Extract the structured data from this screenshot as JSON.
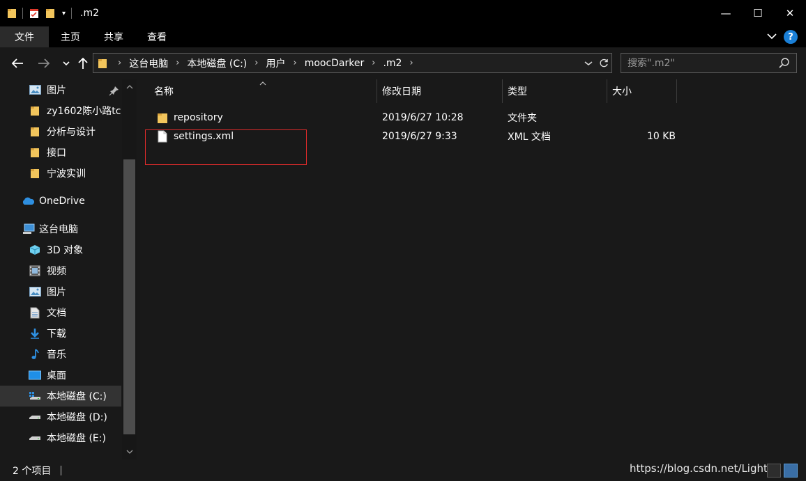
{
  "window": {
    "title": ".m2",
    "minimize_glyph": "—",
    "maximize_glyph": "☐",
    "close_glyph": "✕"
  },
  "ribbon": {
    "tabs": [
      {
        "label": "文件"
      },
      {
        "label": "主页"
      },
      {
        "label": "共享"
      },
      {
        "label": "查看"
      }
    ],
    "help_glyph": "?"
  },
  "address": {
    "crumbs": [
      "这台电脑",
      "本地磁盘 (C:)",
      "用户",
      "moocDarker",
      ".m2"
    ],
    "search_placeholder": "搜索\".m2\""
  },
  "sidebar": {
    "items": [
      {
        "label": "图片",
        "icon": "pictures-icon",
        "pinned": true
      },
      {
        "label": "zy1602陈小路tc",
        "icon": "folder-icon"
      },
      {
        "label": "分析与设计",
        "icon": "folder-icon"
      },
      {
        "label": "接口",
        "icon": "folder-icon"
      },
      {
        "label": "宁波实训",
        "icon": "folder-icon"
      },
      {
        "label": "OneDrive",
        "icon": "onedrive-icon"
      },
      {
        "label": "这台电脑",
        "icon": "this-pc-icon"
      },
      {
        "label": "3D 对象",
        "icon": "3d-objects-icon"
      },
      {
        "label": "视频",
        "icon": "videos-icon"
      },
      {
        "label": "图片",
        "icon": "pictures-icon"
      },
      {
        "label": "文档",
        "icon": "documents-icon"
      },
      {
        "label": "下载",
        "icon": "downloads-icon"
      },
      {
        "label": "音乐",
        "icon": "music-icon"
      },
      {
        "label": "桌面",
        "icon": "desktop-icon"
      },
      {
        "label": "本地磁盘 (C:)",
        "icon": "drive-c-icon",
        "selected": true
      },
      {
        "label": "本地磁盘 (D:)",
        "icon": "drive-icon"
      },
      {
        "label": "本地磁盘 (E:)",
        "icon": "drive-icon"
      }
    ]
  },
  "table": {
    "columns": [
      "名称",
      "修改日期",
      "类型",
      "大小"
    ],
    "rows": [
      {
        "name": "repository",
        "date": "2019/6/27 10:28",
        "type": "文件夹",
        "size": "",
        "icon": "folder-icon"
      },
      {
        "name": "settings.xml",
        "date": "2019/6/27 9:33",
        "type": "XML 文档",
        "size": "10 KB",
        "icon": "file-icon"
      }
    ]
  },
  "status": {
    "item_count": "2 个项目",
    "watermark": "https://blog.csdn.net/LightMi"
  },
  "colors": {
    "folder": "#f2c55c",
    "accent": "#1a7fd6",
    "highlight_box": "#e02b2b"
  }
}
